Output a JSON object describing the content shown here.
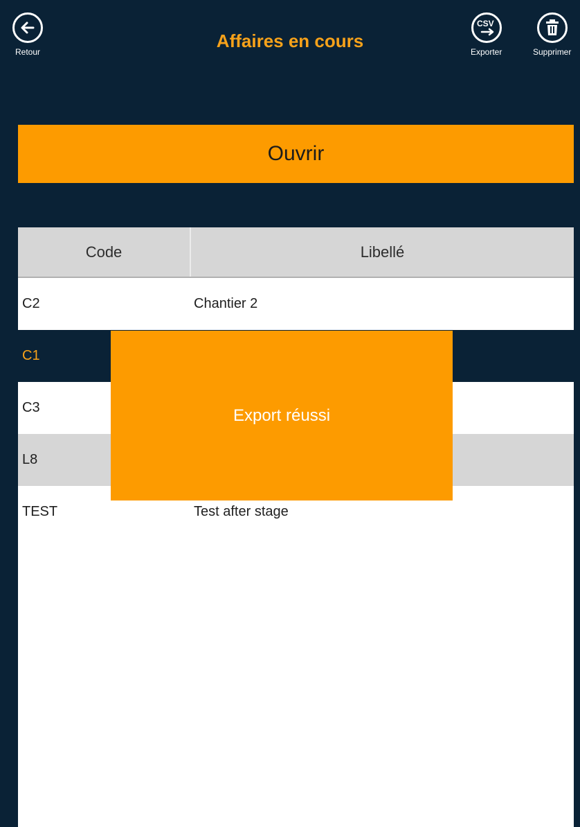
{
  "header": {
    "title": "Affaires en cours",
    "back_label": "Retour",
    "export_label": "Exporter",
    "export_icon_text": "CSV",
    "delete_label": "Supprimer"
  },
  "actions": {
    "open_label": "Ouvrir"
  },
  "table": {
    "columns": [
      "Code",
      "Libellé"
    ],
    "rows": [
      {
        "code": "C2",
        "label": "Chantier 2"
      },
      {
        "code": "C1",
        "label": ""
      },
      {
        "code": "C3",
        "label": ""
      },
      {
        "code": "L8",
        "label": ""
      },
      {
        "code": "TEST",
        "label": "Test after stage"
      }
    ]
  },
  "toast": {
    "message": "Export réussi"
  },
  "colors": {
    "background": "#0a2236",
    "accent": "#fd9b00",
    "title": "#f7a21a",
    "header_row": "#d6d6d6"
  }
}
